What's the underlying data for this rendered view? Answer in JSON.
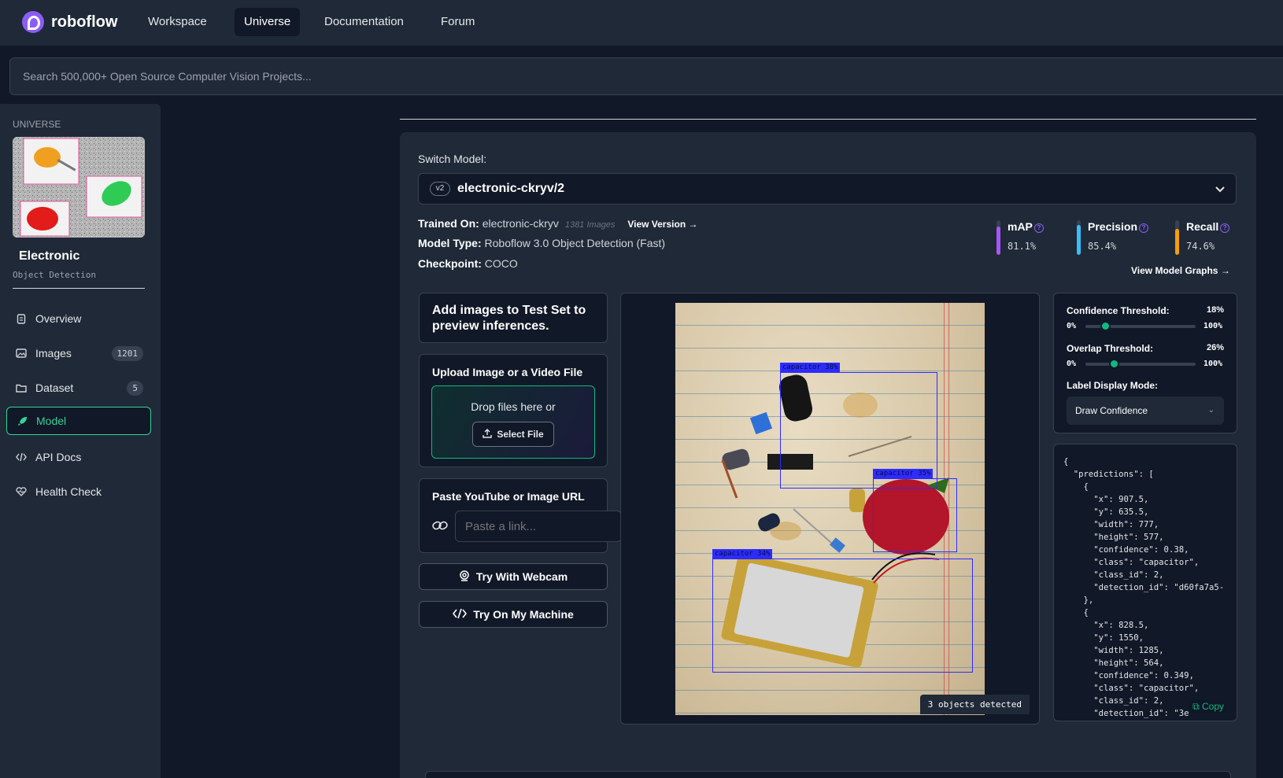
{
  "nav": {
    "brand": "roboflow",
    "links": [
      "Workspace",
      "Universe",
      "Documentation",
      "Forum"
    ],
    "active": "Universe"
  },
  "search": {
    "placeholder": "Search 500,000+ Open Source Computer Vision Projects..."
  },
  "sidebar": {
    "section": "UNIVERSE",
    "project_name": "Electronic",
    "project_type": "Object Detection",
    "items": [
      {
        "label": "Overview",
        "icon": "document-icon"
      },
      {
        "label": "Images",
        "icon": "image-icon",
        "count": "1201"
      },
      {
        "label": "Dataset",
        "icon": "folder-icon",
        "count": "5"
      },
      {
        "label": "Model",
        "icon": "rocket-icon",
        "active": true
      },
      {
        "label": "API Docs",
        "icon": "code-icon"
      },
      {
        "label": "Health Check",
        "icon": "heart-pulse-icon"
      }
    ]
  },
  "model": {
    "switch_label": "Switch Model:",
    "version_badge": "v2",
    "name": "electronic-ckryv/2",
    "trained_on_label": "Trained On:",
    "trained_on": "electronic-ckryv",
    "trained_images": "1381 Images",
    "view_version": "View Version",
    "type_label": "Model Type:",
    "type": "Roboflow 3.0 Object Detection (Fast)",
    "checkpoint_label": "Checkpoint:",
    "checkpoint": "COCO",
    "metrics": [
      {
        "name": "mAP",
        "value": "81.1%",
        "fraction": 0.811,
        "color": "#a855f7"
      },
      {
        "name": "Precision",
        "value": "85.4%",
        "fraction": 0.854,
        "color": "#38bdf8"
      },
      {
        "name": "Recall",
        "value": "74.6%",
        "fraction": 0.746,
        "color": "#f59e0b"
      }
    ],
    "view_graphs": "View Model Graphs"
  },
  "actions": {
    "add_title": "Add images to Test Set to preview inferences.",
    "upload_title": "Upload Image or a Video File",
    "drop_text": "Drop files here or",
    "select_file": "Select File",
    "paste_title": "Paste YouTube or Image URL",
    "paste_placeholder": "Paste a link...",
    "webcam": "Try With Webcam",
    "machine": "Try On My Machine"
  },
  "preview": {
    "detections": [
      {
        "label": "capacitor 38%"
      },
      {
        "label": "capacitor 35%"
      },
      {
        "label": "capacitor 34%"
      }
    ],
    "objects_detected": "3 objects detected"
  },
  "controls": {
    "confidence_label": "Confidence Threshold:",
    "confidence_value": "18%",
    "confidence_fraction": 0.18,
    "overlap_label": "Overlap Threshold:",
    "overlap_value": "26%",
    "overlap_fraction": 0.26,
    "min": "0%",
    "max": "100%",
    "label_mode_label": "Label Display Mode:",
    "label_mode": "Draw Confidence"
  },
  "json_output": {
    "text": "{\n  \"predictions\": [\n    {\n      \"x\": 907.5,\n      \"y\": 635.5,\n      \"width\": 777,\n      \"height\": 577,\n      \"confidence\": 0.38,\n      \"class\": \"capacitor\",\n      \"class_id\": 2,\n      \"detection_id\": \"d60fa7a5-\n    },\n    {\n      \"x\": 828.5,\n      \"y\": 1550,\n      \"width\": 1285,\n      \"height\": 564,\n      \"confidence\": 0.349,\n      \"class\": \"capacitor\",\n      \"class_id\": 2,\n      \"detection_id\": \"3e",
    "copy": "Copy"
  }
}
